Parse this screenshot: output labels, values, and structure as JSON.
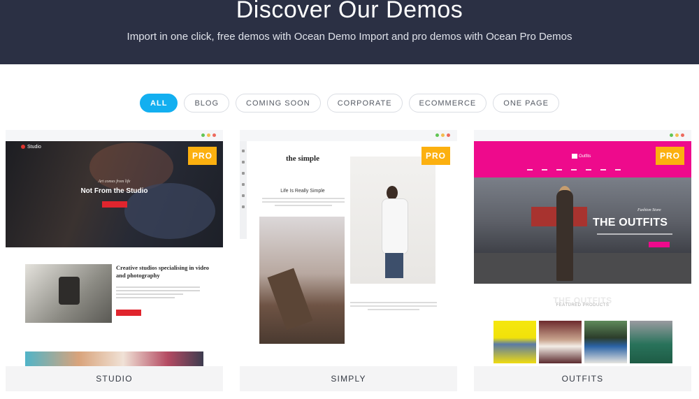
{
  "header": {
    "title": "Discover Our Demos",
    "subtitle": "Import in one click, free demos with Ocean Demo Import and pro demos with Ocean Pro Demos"
  },
  "filters": [
    {
      "label": "ALL",
      "active": true
    },
    {
      "label": "BLOG",
      "active": false
    },
    {
      "label": "COMING SOON",
      "active": false
    },
    {
      "label": "CORPORATE",
      "active": false
    },
    {
      "label": "ECOMMERCE",
      "active": false
    },
    {
      "label": "ONE PAGE",
      "active": false
    }
  ],
  "colors": {
    "header_bg": "#2b3044",
    "accent": "#13aff0",
    "pro_badge": "#fcb00f",
    "studio_red": "#e0252e",
    "outfits_pink": "#ee0a8c"
  },
  "demos": [
    {
      "name": "STUDIO",
      "badge": "PRO",
      "preview": {
        "logo": "Studio",
        "hero_small": "Art comes from life",
        "hero_title": "Not From the Studio",
        "section_heading": "Creative studios specialising in video and photography"
      }
    },
    {
      "name": "SIMPLY",
      "badge": "PRO",
      "preview": {
        "logo": "the simple",
        "tagline": "Life Is Really Simple"
      }
    },
    {
      "name": "OUTFITS",
      "badge": "PRO",
      "preview": {
        "logo": "Outfits",
        "hero_small": "Fashion Store",
        "hero_title": "THE OUTFITS",
        "section_title": "THE OUTFITS",
        "section_sub": "FEATURED PRODUCTS"
      }
    }
  ]
}
